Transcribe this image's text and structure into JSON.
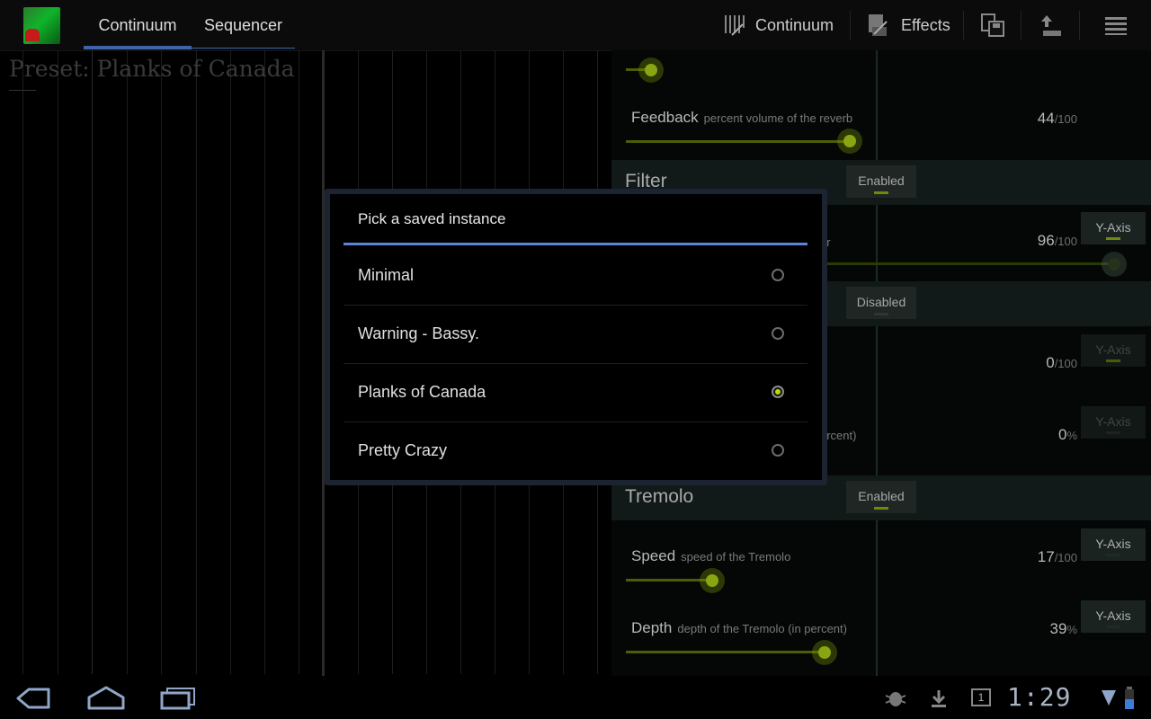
{
  "action_bar": {
    "tabs": [
      {
        "label": "Continuum",
        "active": true
      },
      {
        "label": "Sequencer",
        "active": false
      }
    ],
    "buttons": [
      {
        "label": "Continuum",
        "icon": "keyboard-icon"
      },
      {
        "label": "Effects",
        "icon": "effects-icon"
      },
      {
        "label": "",
        "icon": "save-preset-icon"
      },
      {
        "label": "",
        "icon": "upload-preset-icon"
      },
      {
        "label": "",
        "icon": "menu-icon"
      }
    ]
  },
  "preset": {
    "title": "Preset: Planks of Canada"
  },
  "effects": {
    "feedback": {
      "label": "Feedback",
      "desc": "percent volume of the reverb",
      "value": "44",
      "unit": "/100",
      "level": 0.44
    },
    "filter": {
      "title": "Filter",
      "state": "Enabled"
    },
    "filter_param1": {
      "label_fragment": "er",
      "value": "96",
      "unit": "/100",
      "level": 0.96,
      "axis": "Y-Axis"
    },
    "section2": {
      "state": "Disabled"
    },
    "section2_param1": {
      "value": "0",
      "unit": "/100",
      "axis": "Y-Axis"
    },
    "section2_param2": {
      "desc_fragment": "ercent)",
      "value": "0",
      "unit": "%",
      "axis": "Y-Axis"
    },
    "tremolo": {
      "title": "Tremolo",
      "state": "Enabled"
    },
    "speed": {
      "label": "Speed",
      "desc": "speed of the Tremolo",
      "value": "17",
      "unit": "/100",
      "level": 0.17,
      "axis": "Y-Axis"
    },
    "depth": {
      "label": "Depth",
      "desc": "depth of the Tremolo (in percent)",
      "value": "39",
      "unit": "%",
      "level": 0.39,
      "axis": "Y-Axis"
    }
  },
  "dialog": {
    "title": "Pick a saved instance",
    "options": [
      {
        "label": "Minimal",
        "selected": false
      },
      {
        "label": "Warning - Bassy.",
        "selected": false
      },
      {
        "label": "Planks of Canada",
        "selected": true
      },
      {
        "label": "Pretty Crazy",
        "selected": false
      }
    ]
  },
  "system_bar": {
    "time": "1:29",
    "notification_icons": [
      "debug-icon",
      "download-icon",
      "calendar-icon"
    ],
    "calendar_day": "1"
  },
  "colors": {
    "accent": "#5f83d6",
    "slider": "#8ba512",
    "tab_indicator": "#3d63a8"
  }
}
